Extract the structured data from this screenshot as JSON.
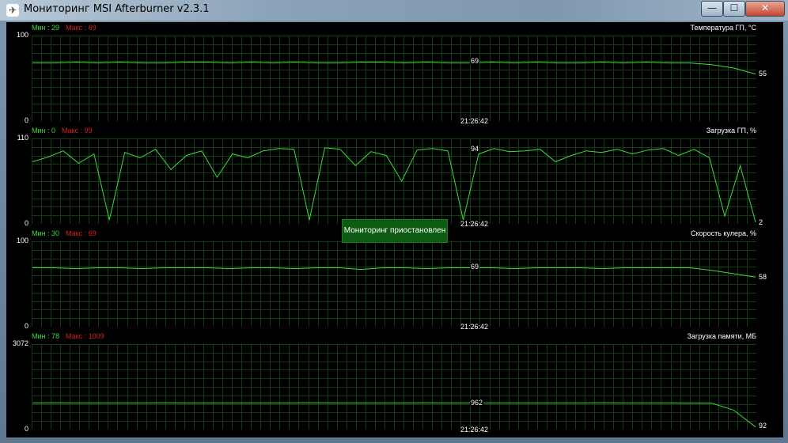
{
  "window": {
    "title": "Мониторинг MSI Afterburner v2.3.1",
    "controls": {
      "minimize": "—",
      "maximize": "☐",
      "close": "✕"
    }
  },
  "overlay_message": "Мониторинг приостановлен",
  "graphs": [
    {
      "title": "Температура ГП, °C",
      "min_label": "Мин : 29",
      "max_label": "Макс : 69",
      "y_max": "100",
      "y_min": "0",
      "time": "21:26:42",
      "cursor_value": "69",
      "end_value": "55"
    },
    {
      "title": "Загрузка ГП, %",
      "min_label": "Мин : 0",
      "max_label": "Макс : 99",
      "y_max": "110",
      "y_min": "0",
      "time": "21:26:42",
      "cursor_value": "94",
      "end_value": "2"
    },
    {
      "title": "Скорость кулера, %",
      "min_label": "Мин : 30",
      "max_label": "Макс : 69",
      "y_max": "100",
      "y_min": "0",
      "time": "21:26:42",
      "cursor_value": "69",
      "end_value": "58"
    },
    {
      "title": "Загрузка памяти, МБ",
      "min_label": "Мин : 78",
      "max_label": "Макс : 1009",
      "y_max": "3072",
      "y_min": "0",
      "time": "21:26:42",
      "cursor_value": "962",
      "end_value": "92"
    }
  ],
  "colors": {
    "trace": "#3cdc3c",
    "grid": "#123d12",
    "max_label": "#d81e1e",
    "overlay": "#0d5a12"
  },
  "chart_data": [
    {
      "type": "line",
      "title": "Температура ГП, °C",
      "ylim": [
        0,
        100
      ],
      "grid": true,
      "series": [
        {
          "values": [
            68,
            68,
            69,
            68,
            69,
            68,
            68,
            69,
            69,
            68,
            69,
            68,
            69,
            68,
            68,
            69,
            69,
            68,
            69,
            68,
            68,
            69,
            68,
            69,
            68,
            68,
            69,
            68,
            69,
            68,
            68,
            66,
            62,
            55
          ]
        }
      ]
    },
    {
      "type": "line",
      "title": "Загрузка ГП, %",
      "ylim": [
        0,
        110
      ],
      "grid": true,
      "series": [
        {
          "values": [
            80,
            86,
            94,
            78,
            90,
            5,
            92,
            85,
            96,
            70,
            88,
            94,
            60,
            90,
            85,
            94,
            97,
            96,
            5,
            98,
            96,
            75,
            93,
            88,
            55,
            95,
            97,
            94,
            5,
            90,
            97,
            93,
            94,
            96,
            80,
            88,
            94,
            92,
            96,
            90,
            95,
            97,
            88,
            96,
            85,
            10,
            75,
            2
          ]
        }
      ]
    },
    {
      "type": "line",
      "title": "Скорость кулера, %",
      "ylim": [
        0,
        100
      ],
      "grid": true,
      "series": [
        {
          "values": [
            69,
            69,
            68,
            69,
            69,
            68,
            69,
            69,
            69,
            68,
            69,
            69,
            68,
            69,
            69,
            67,
            69,
            69,
            68,
            69,
            69,
            69,
            68,
            69,
            69,
            69,
            68,
            69,
            69,
            69,
            69,
            66,
            62,
            58
          ]
        }
      ]
    },
    {
      "type": "line",
      "title": "Загрузка памяти, МБ",
      "ylim": [
        0,
        3072
      ],
      "grid": true,
      "series": [
        {
          "values": [
            962,
            965,
            960,
            962,
            958,
            962,
            965,
            962,
            960,
            962,
            962,
            958,
            962,
            965,
            962,
            962,
            960,
            962,
            965,
            962,
            962,
            958,
            962,
            962,
            960,
            962,
            965,
            962,
            962,
            960,
            955,
            950,
            700,
            92
          ]
        }
      ]
    }
  ]
}
